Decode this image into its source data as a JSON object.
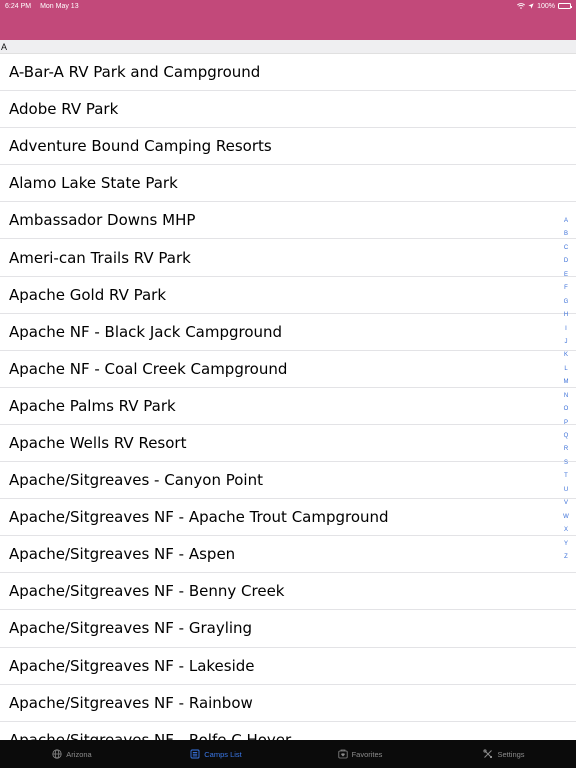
{
  "status_bar": {
    "time": "6:24 PM",
    "date": "Mon May 13",
    "battery": "100%"
  },
  "section": {
    "letter": "A"
  },
  "camps": [
    "A-Bar-A RV Park and Campground",
    "Adobe RV Park",
    "Adventure Bound Camping Resorts",
    "Alamo Lake State Park",
    "Ambassador Downs MHP",
    "Ameri-can Trails RV Park",
    "Apache Gold RV Park",
    "Apache NF - Black Jack Campground",
    "Apache NF - Coal Creek Campground",
    "Apache Palms RV Park",
    "Apache Wells RV Resort",
    "Apache/Sitgreaves - Canyon Point",
    "Apache/Sitgreaves NF - Apache Trout Campground",
    "Apache/Sitgreaves NF - Aspen",
    "Apache/Sitgreaves NF - Benny Creek",
    "Apache/Sitgreaves NF - Grayling",
    "Apache/Sitgreaves NF - Lakeside",
    "Apache/Sitgreaves NF - Rainbow",
    "Apache/Sitgreaves NF - Rolfe C Hoyer"
  ],
  "index_letters": [
    "A",
    "B",
    "C",
    "D",
    "E",
    "F",
    "G",
    "H",
    "I",
    "J",
    "K",
    "L",
    "M",
    "N",
    "O",
    "P",
    "Q",
    "R",
    "S",
    "T",
    "U",
    "V",
    "W",
    "X",
    "Y",
    "Z"
  ],
  "tabs": [
    {
      "label": "Arizona",
      "icon": "globe-icon",
      "active": false
    },
    {
      "label": "Camps List",
      "icon": "list-icon",
      "active": true
    },
    {
      "label": "Favorites",
      "icon": "favorites-icon",
      "active": false
    },
    {
      "label": "Settings",
      "icon": "tools-icon",
      "active": false
    }
  ],
  "colors": {
    "header": "#c2497a",
    "accent": "#3a78e8",
    "tabbar": "#0b0b0b"
  }
}
